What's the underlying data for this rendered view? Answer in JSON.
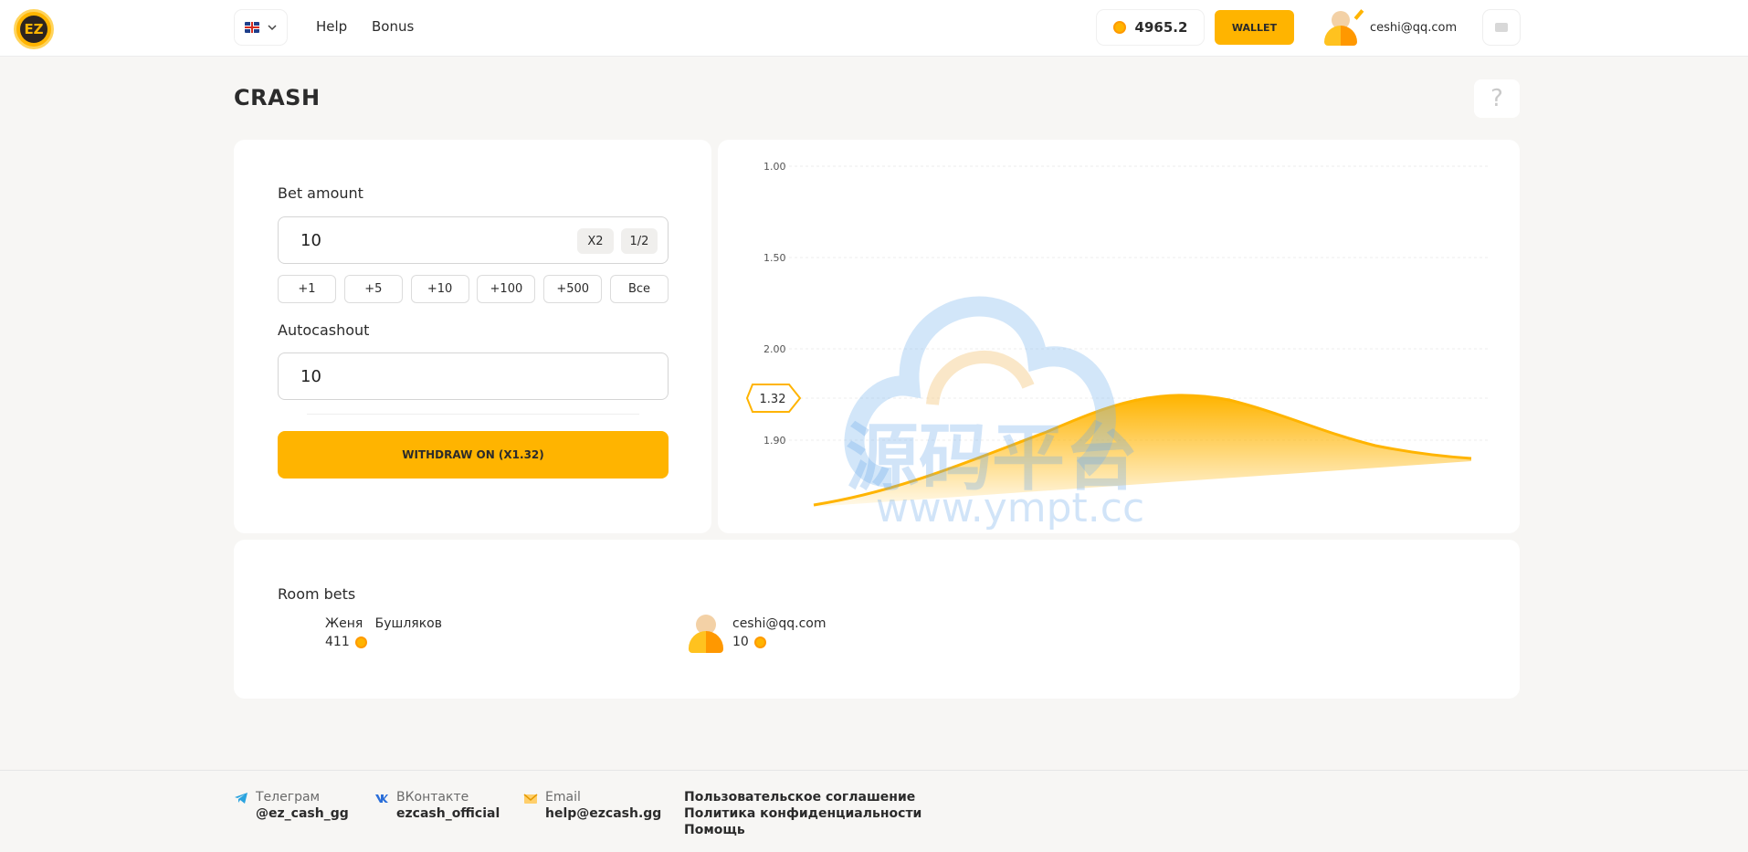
{
  "header": {
    "logo_text": "EZ",
    "nav": [
      "Help",
      "Bonus"
    ],
    "balance": "4965.2",
    "wallet_label": "WALLET",
    "user_email": "ceshi@qq.com"
  },
  "page": {
    "title": "CRASH",
    "help_glyph": "?"
  },
  "bet_panel": {
    "bet_label": "Bet amount",
    "bet_value": "10",
    "double_label": "X2",
    "half_label": "1/2",
    "quick_amounts": [
      "+1",
      "+5",
      "+10",
      "+100",
      "+500",
      "Все"
    ],
    "autocashout_label": "Autocashout",
    "autocashout_value": "10",
    "withdraw_label": "WITHDRAW ON (X1.32)"
  },
  "chart_data": {
    "type": "area",
    "y_tick_labels": [
      "1.00",
      "1.50",
      "2.00",
      "1.90"
    ],
    "current_multiplier": "1.32",
    "accent_color": "#ffb400",
    "grid": true
  },
  "watermark": {
    "title": "源码平台",
    "url": "www.ympt.cc"
  },
  "room_bets": {
    "title": "Room bets",
    "entries": [
      {
        "name": "Женя   Бушляков",
        "amount": "411",
        "has_avatar": false
      },
      {
        "name": "ceshi@qq.com",
        "amount": "10",
        "has_avatar": true
      }
    ]
  },
  "footer": {
    "contacts": [
      {
        "icon": "telegram-icon",
        "label": "Телеграм",
        "value": "@ez_cash_gg"
      },
      {
        "icon": "vk-icon",
        "label": "ВКонтакте",
        "value": "ezcash_official"
      },
      {
        "icon": "email-icon",
        "label": "Email",
        "value": "help@ezcash.gg"
      }
    ],
    "links": [
      "Пользовательское соглашение",
      "Политика конфиденциальности",
      "Помощь"
    ]
  },
  "colors": {
    "accent": "#ffb400",
    "background": "#f7f6f4"
  }
}
